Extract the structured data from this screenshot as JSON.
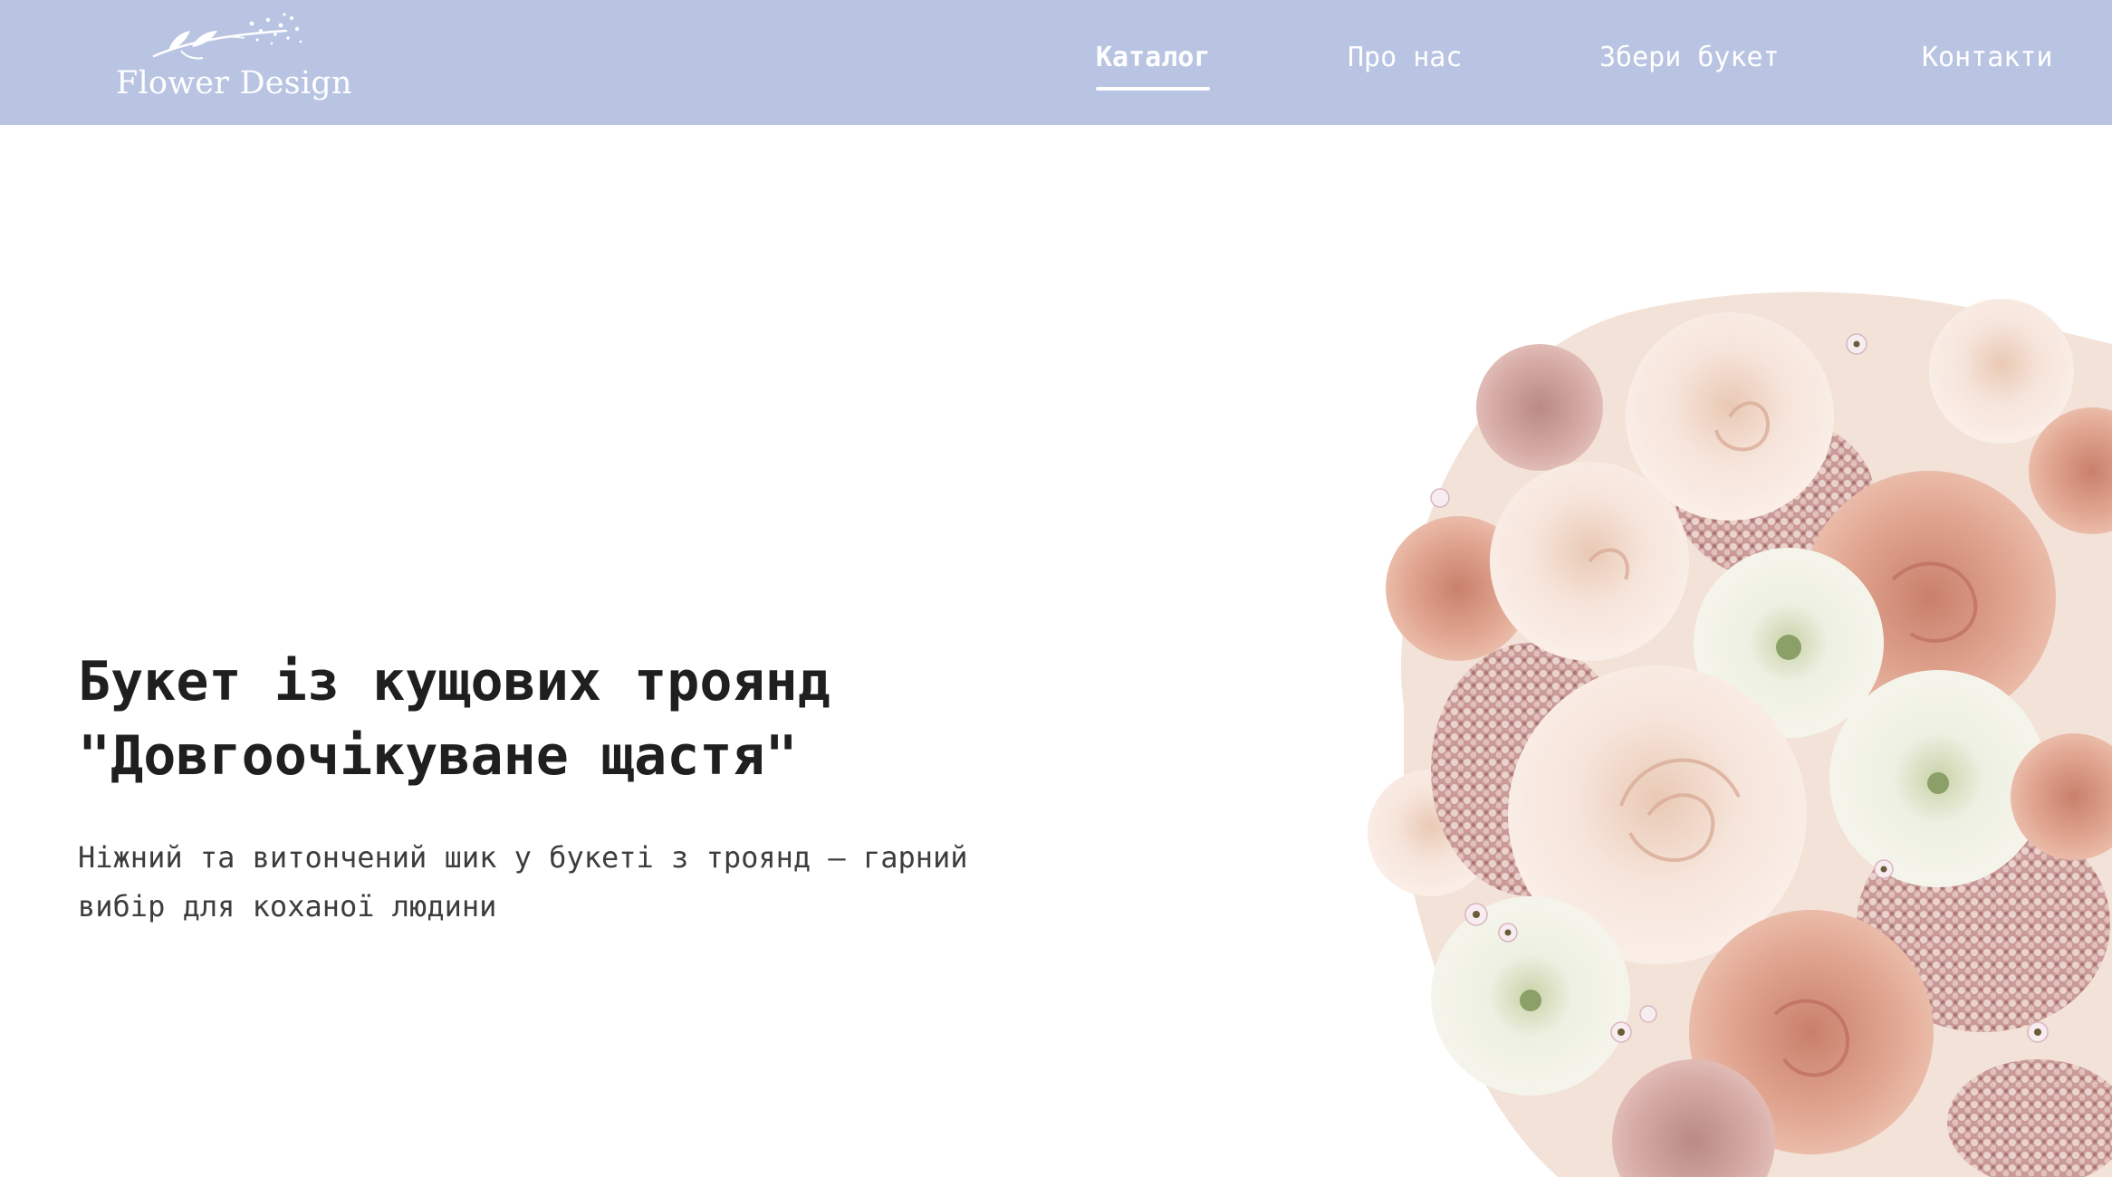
{
  "header": {
    "background": "#b9c4e2",
    "logo": {
      "text": "Flower Design",
      "icon": "flower-branch-icon"
    },
    "nav": [
      {
        "label": "Каталог",
        "active": true
      },
      {
        "label": "Про нас",
        "active": false
      },
      {
        "label": "Збери букет",
        "active": false
      },
      {
        "label": "Контакти",
        "active": false
      }
    ]
  },
  "hero": {
    "title_line1": "Букет із кущових троянд",
    "title_line2": "\"Довгоочікуване щастя\"",
    "subtitle_line1": "Ніжний та витончений шик у букеті з троянд — гарний",
    "subtitle_line2": "вибір для коханої людини",
    "image": "rose-bouquet-image"
  },
  "colors": {
    "header_bg": "#b9c4e2",
    "title_text": "#1f1f1f",
    "body_text": "#3d3d3d",
    "nav_text": "#ffffff"
  }
}
